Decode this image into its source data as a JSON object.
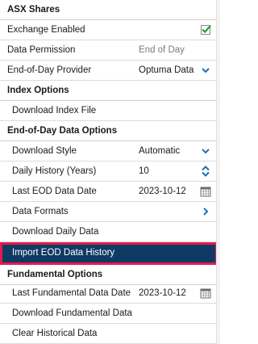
{
  "sections": {
    "asx_shares": "ASX Shares",
    "index_options": "Index Options",
    "eod_options": "End-of-Day Data Options",
    "fundamental_options": "Fundamental Options"
  },
  "asx": {
    "exchange_enabled_label": "Exchange Enabled",
    "exchange_enabled_checked": true,
    "data_permission_label": "Data Permission",
    "data_permission_value": "End of Day",
    "eod_provider_label": "End-of-Day Provider",
    "eod_provider_value": "Optuma Data"
  },
  "index": {
    "download_index_file_label": "Download Index File"
  },
  "eod": {
    "download_style_label": "Download Style",
    "download_style_value": "Automatic",
    "daily_history_label": "Daily History (Years)",
    "daily_history_value": "10",
    "last_eod_date_label": "Last EOD Data Date",
    "last_eod_date_value": "2023-10-12",
    "data_formats_label": "Data Formats",
    "download_daily_label": "Download Daily Data",
    "import_eod_history_label": "Import EOD Data History"
  },
  "fundamental": {
    "last_fundamental_date_label": "Last Fundamental Data Date",
    "last_fundamental_date_value": "2023-10-12",
    "download_fundamental_label": "Download Fundamental Data",
    "clear_historical_label": "Clear Historical Data"
  },
  "colors": {
    "accent": "#1e6fb8",
    "selected_bg": "#0f3a63",
    "highlight_border": "#e31c4b",
    "check_green": "#2e9b2e"
  }
}
